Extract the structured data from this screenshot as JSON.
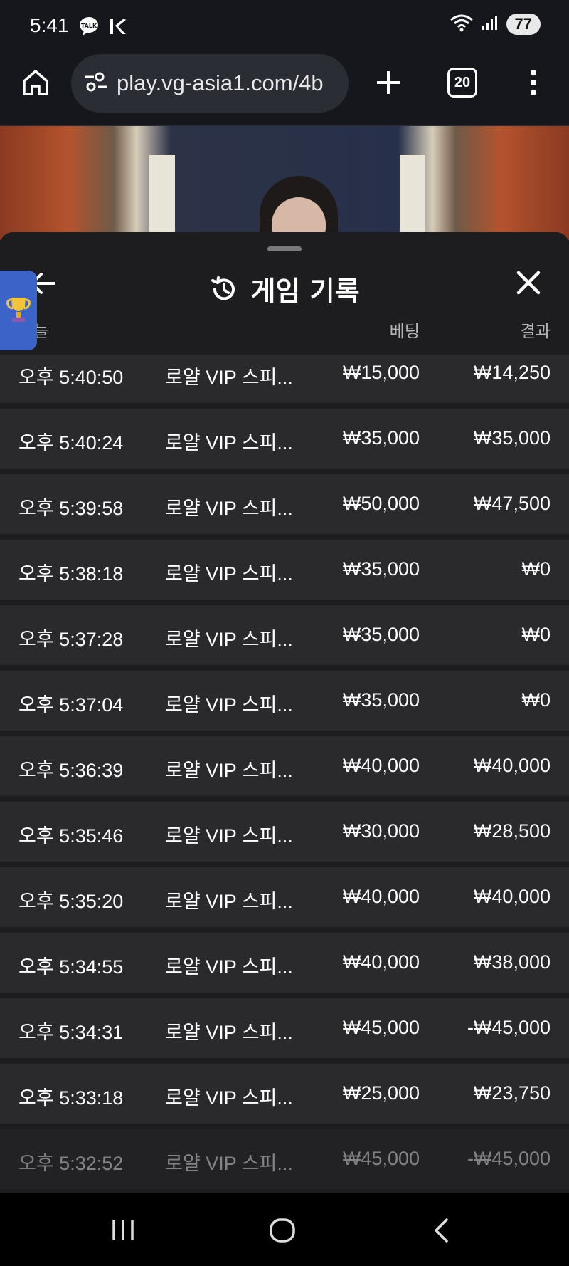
{
  "status_bar": {
    "time": "5:41",
    "battery": "77"
  },
  "browser": {
    "url": "play.vg-asia1.com/4b",
    "tab_count": "20"
  },
  "sheet": {
    "title": "게임 기록",
    "columns": {
      "date": "오늘",
      "bet": "베팅",
      "result": "결과"
    }
  },
  "records": [
    {
      "time": "오후 5:40:50",
      "game": "로얄 VIP 스피...",
      "bet": "₩15,000",
      "result": "₩14,250"
    },
    {
      "time": "오후 5:40:24",
      "game": "로얄 VIP 스피...",
      "bet": "₩35,000",
      "result": "₩35,000"
    },
    {
      "time": "오후 5:39:58",
      "game": "로얄 VIP 스피...",
      "bet": "₩50,000",
      "result": "₩47,500"
    },
    {
      "time": "오후 5:38:18",
      "game": "로얄 VIP 스피...",
      "bet": "₩35,000",
      "result": "₩0"
    },
    {
      "time": "오후 5:37:28",
      "game": "로얄 VIP 스피...",
      "bet": "₩35,000",
      "result": "₩0"
    },
    {
      "time": "오후 5:37:04",
      "game": "로얄 VIP 스피...",
      "bet": "₩35,000",
      "result": "₩0"
    },
    {
      "time": "오후 5:36:39",
      "game": "로얄 VIP 스피...",
      "bet": "₩40,000",
      "result": "₩40,000"
    },
    {
      "time": "오후 5:35:46",
      "game": "로얄 VIP 스피...",
      "bet": "₩30,000",
      "result": "₩28,500"
    },
    {
      "time": "오후 5:35:20",
      "game": "로얄 VIP 스피...",
      "bet": "₩40,000",
      "result": "₩40,000"
    },
    {
      "time": "오후 5:34:55",
      "game": "로얄 VIP 스피...",
      "bet": "₩40,000",
      "result": "₩38,000"
    },
    {
      "time": "오후 5:34:31",
      "game": "로얄 VIP 스피...",
      "bet": "₩45,000",
      "result": "-₩45,000"
    },
    {
      "time": "오후 5:33:18",
      "game": "로얄 VIP 스피...",
      "bet": "₩25,000",
      "result": "₩23,750"
    },
    {
      "time": "오후 5:32:52",
      "game": "로얄 VIP 스피...",
      "bet": "₩45,000",
      "result": "-₩45,000"
    }
  ]
}
